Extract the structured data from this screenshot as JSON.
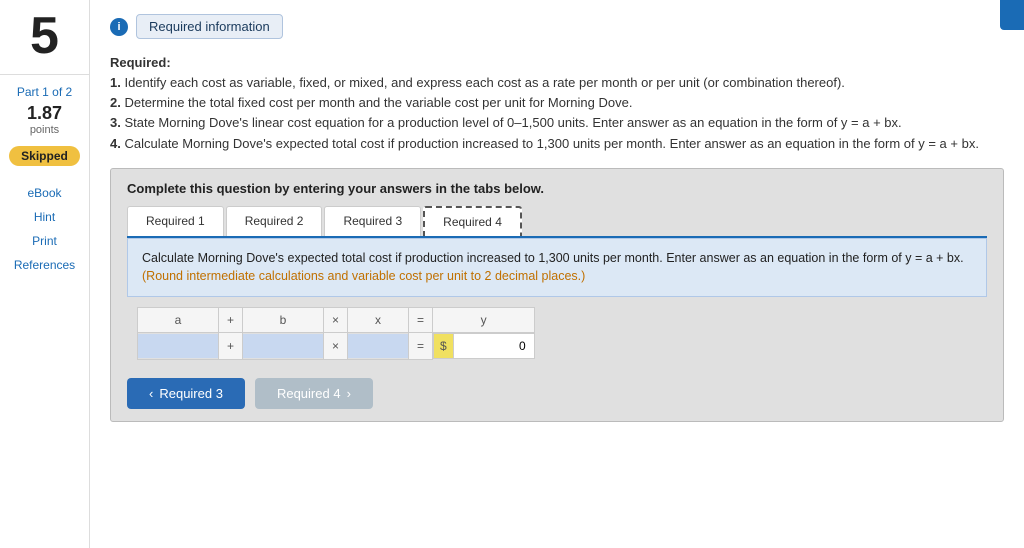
{
  "sidebar": {
    "number": "5",
    "part_label": "Part 1 of 2",
    "points_value": "1.87",
    "points_label": "points",
    "badge": "Skipped",
    "links": [
      "eBook",
      "Hint",
      "Print",
      "References"
    ]
  },
  "header": {
    "info_icon": "i",
    "title": "Required information"
  },
  "required_section": {
    "label": "Required:",
    "items": [
      "Identify each cost as variable, fixed, or mixed, and express each cost as a rate per month or per unit (or combination thereof).",
      "Determine the total fixed cost per month and the variable cost per unit for Morning Dove.",
      "State Morning Dove's linear cost equation for a production level of 0–1,500 units. Enter answer as an equation in the form of y = a + bx.",
      "Calculate Morning Dove's expected total cost if production increased to 1,300 units per month. Enter answer as an equation in the form of y = a + bx."
    ]
  },
  "complete_box": {
    "text": "Complete this question by entering your answers in the tabs below."
  },
  "tabs": [
    {
      "label": "Required 1"
    },
    {
      "label": "Required 2"
    },
    {
      "label": "Required 3"
    },
    {
      "label": "Required 4"
    }
  ],
  "active_tab_index": 3,
  "blue_info": {
    "main": "Calculate Morning Dove's expected total cost if production increased to 1,300 units per month. Enter answer as an equation in the form of y = a + bx.",
    "note": "(Round intermediate calculations and variable cost per unit to 2 decimal places.)"
  },
  "equation": {
    "col_a": "a",
    "col_plus": "+",
    "col_b": "b",
    "col_times": "×",
    "col_x": "x",
    "col_equals": "=",
    "col_y": "y",
    "val_a": "",
    "val_b": "",
    "val_x": "",
    "dollar_sign": "$",
    "val_y": "0"
  },
  "nav": {
    "prev_label": "Required 3",
    "next_label": "Required 4",
    "prev_icon": "‹",
    "next_icon": "›"
  }
}
